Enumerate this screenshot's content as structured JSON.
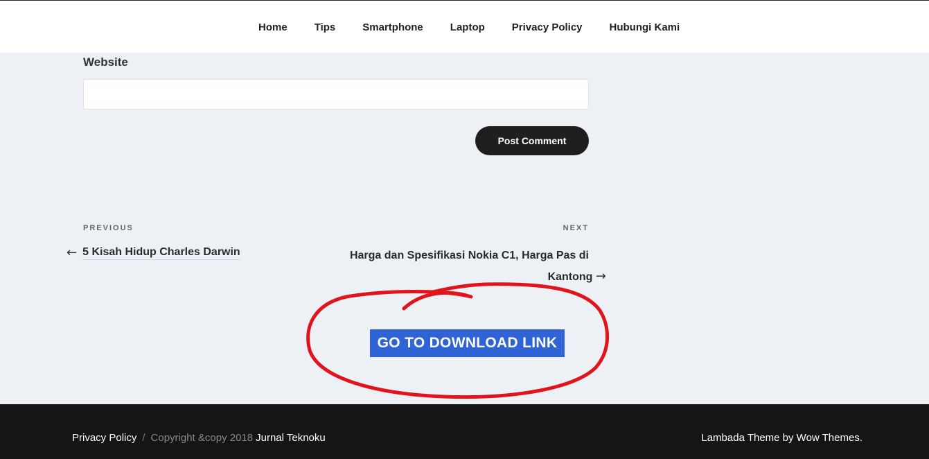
{
  "nav": {
    "items": [
      "Home",
      "Tips",
      "Smartphone",
      "Laptop",
      "Privacy Policy",
      "Hubungi Kami"
    ]
  },
  "comment_form": {
    "website_label": "Website",
    "website_value": "",
    "post_button": "Post Comment"
  },
  "post_nav": {
    "previous_label": "PREVIOUS",
    "previous_title": "5 Kisah Hidup Charles Darwin",
    "next_label": "NEXT",
    "next_title_line1": "Harga dan Spesifikasi Nokia C1, Harga Pas di",
    "next_title_line2": "Kantong"
  },
  "download": {
    "label": "GO TO DOWNLOAD LINK",
    "button_color": "#2f63d6",
    "annotation_color": "#e0141a"
  },
  "footer": {
    "privacy": "Privacy Policy",
    "separator": "/",
    "copyright": "Copyright &copy 2018",
    "site_name": "Jurnal Teknoku",
    "credit": "Lambada Theme by Wow Themes."
  }
}
